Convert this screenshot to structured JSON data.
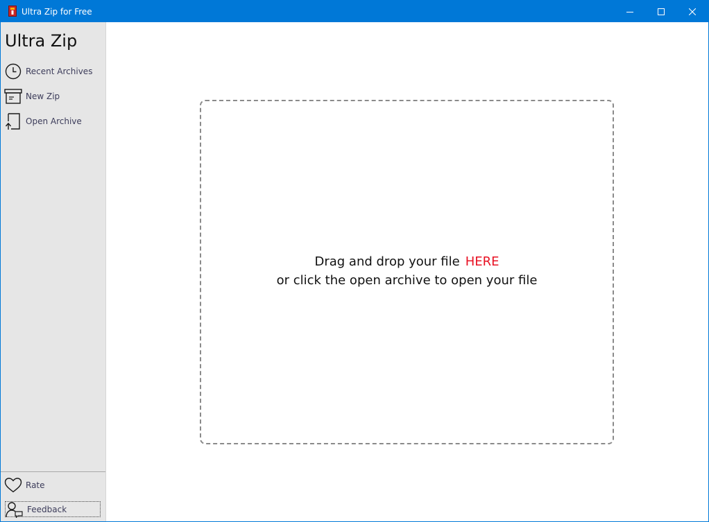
{
  "window": {
    "title": "Ultra Zip for Free",
    "controls": {
      "minimize_icon": "minimize-icon",
      "maximize_icon": "maximize-icon",
      "close_icon": "close-icon"
    }
  },
  "sidebar": {
    "brand": "Ultra Zip",
    "items": [
      {
        "label": "Recent Archives",
        "icon": "clock-icon"
      },
      {
        "label": "New Zip",
        "icon": "archive-box-icon"
      },
      {
        "label": "Open Archive",
        "icon": "open-archive-icon"
      }
    ],
    "footer": [
      {
        "label": "Rate",
        "icon": "heart-icon"
      },
      {
        "label": "Feedback",
        "icon": "feedback-person-icon"
      }
    ]
  },
  "dropzone": {
    "line1": "Drag and drop your file",
    "highlight": "HERE",
    "line2": "or click the open archive to open your file"
  },
  "colors": {
    "titlebar": "#0078d7",
    "sidebar": "#e6e6e6",
    "highlight": "#e81123"
  }
}
